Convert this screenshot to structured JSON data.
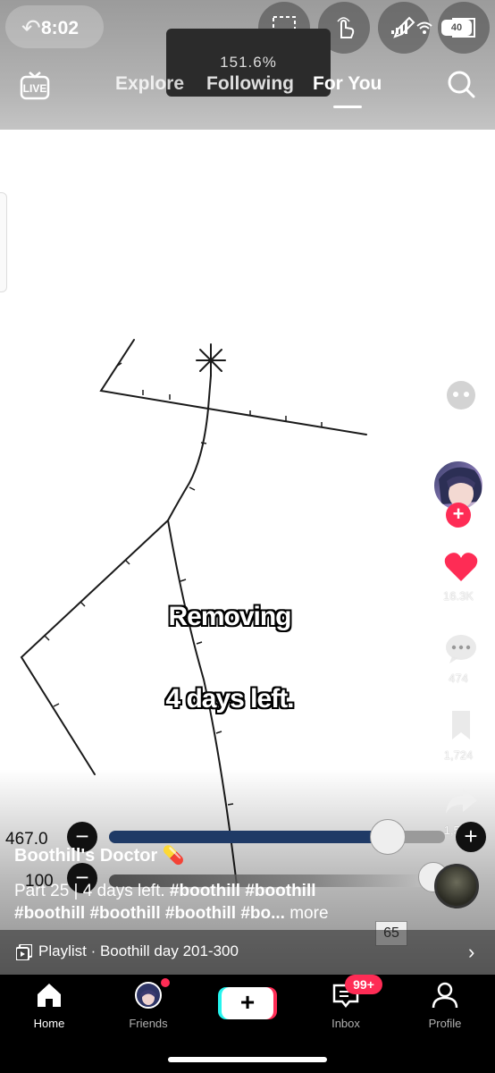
{
  "status_bar": {
    "time": "8:02",
    "battery": "40",
    "zoom_level": "151.6%"
  },
  "top_nav": {
    "live_label": "LIVE",
    "tabs": [
      {
        "label": "Explore",
        "active": false
      },
      {
        "label": "Following",
        "active": false
      },
      {
        "label": "For You",
        "active": true
      }
    ]
  },
  "video": {
    "captions": [
      "Removing",
      "4 days left."
    ]
  },
  "actions": {
    "likes": "16.3K",
    "comments": "474",
    "saves": "1,724",
    "shares": "1,543"
  },
  "overlay_sliders": {
    "size_value": "467.0",
    "opacity_value": "100",
    "size_fill_fraction": 0.83,
    "size_knob_label": "467.0",
    "layer_count": "65"
  },
  "post": {
    "username": "Boothill's Doctor",
    "username_emoji": "💊",
    "description_lead": "Part 25 | 4 days left.",
    "hashtags_line1": [
      "#boothill",
      "#boothill"
    ],
    "hashtags_line2": [
      "#boothill",
      "#boothill",
      "#boothill",
      "#bo..."
    ],
    "more_label": "more"
  },
  "playlist": {
    "label": "Playlist · Boothill day 201-300"
  },
  "bottom_nav": {
    "items": [
      {
        "label": "Home",
        "active": true
      },
      {
        "label": "Friends",
        "active": false
      },
      {
        "label": "",
        "active": false
      },
      {
        "label": "Inbox",
        "active": false,
        "badge": "99+"
      },
      {
        "label": "Profile",
        "active": false
      }
    ]
  },
  "colors": {
    "accent_red": "#fe2c55",
    "accent_cyan": "#25f4ee",
    "slider_fill": "#1f3a66"
  }
}
